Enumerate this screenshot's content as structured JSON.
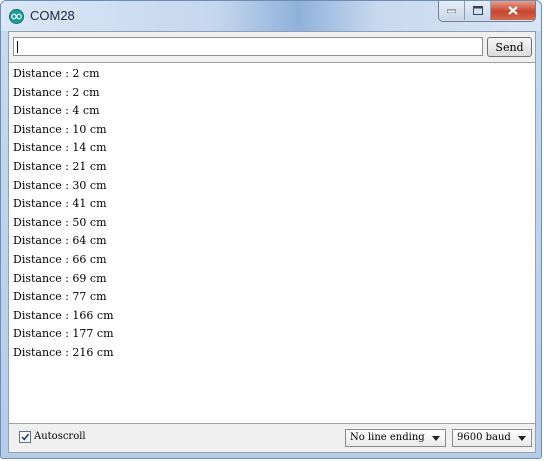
{
  "window": {
    "title": "COM28",
    "app_icon": "arduino-infinity-icon",
    "buttons": {
      "minimize": "minimize-icon",
      "maximize": "maximize-icon",
      "close": "close-icon"
    }
  },
  "send_bar": {
    "input_value": "",
    "send_label": "Send"
  },
  "output": {
    "lines": [
      "Distance : 2 cm",
      "Distance : 2 cm",
      "Distance : 4 cm",
      "Distance : 10 cm",
      "Distance : 14 cm",
      "Distance : 21 cm",
      "Distance : 30 cm",
      "Distance : 41 cm",
      "Distance : 50 cm",
      "Distance : 64 cm",
      "Distance : 66 cm",
      "Distance : 69 cm",
      "Distance : 77 cm",
      "Distance : 166 cm",
      "Distance : 177 cm",
      "Distance : 216 cm"
    ]
  },
  "footer": {
    "autoscroll_label": "Autoscroll",
    "autoscroll_checked": true,
    "line_ending": "No line ending",
    "baud_rate": "9600 baud"
  }
}
